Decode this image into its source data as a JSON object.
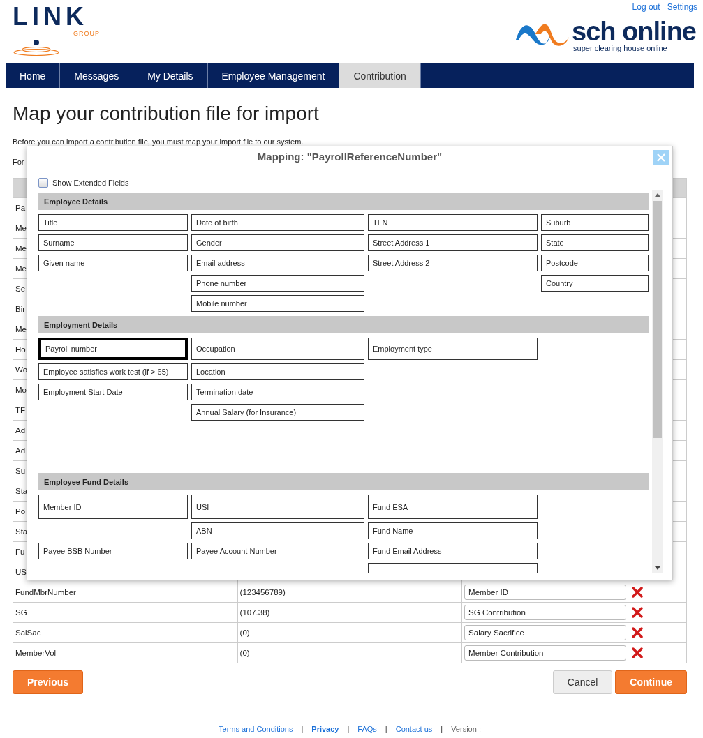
{
  "header": {
    "links": [
      "Log out",
      "Settings"
    ],
    "logo": {
      "name": "LINK",
      "sub": "GROUP"
    },
    "brand": {
      "name": "sch online",
      "tagline": "super clearing house online"
    }
  },
  "nav": [
    {
      "label": "Home",
      "selected": false
    },
    {
      "label": "Messages",
      "selected": false
    },
    {
      "label": "My Details",
      "selected": false
    },
    {
      "label": "Employee Management",
      "selected": false
    },
    {
      "label": "Contribution",
      "selected": true
    }
  ],
  "title": "Map your contribution file for import",
  "intro": "Before you can import a contribution file, you must map your import file to our system.",
  "intro_2": "For",
  "table": {
    "rows": [
      {
        "column_1": "Pa"
      },
      {
        "column_1": "Me"
      },
      {
        "column_1": "Me"
      },
      {
        "column_1": "Me"
      },
      {
        "column_1": "Se"
      },
      {
        "column_1": "Bir"
      },
      {
        "column_1": "Me"
      },
      {
        "column_1": "Ho"
      },
      {
        "column_1": "Wo"
      },
      {
        "column_1": "Mo"
      },
      {
        "column_1": "TF"
      },
      {
        "column_1": "Ad"
      },
      {
        "column_1": "Ad"
      },
      {
        "column_1": "Su"
      },
      {
        "column_1": "Sta"
      },
      {
        "column_1": "Po"
      },
      {
        "column_1": "Sta"
      },
      {
        "column_1": "Fu"
      },
      {
        "column_1": "US"
      },
      {
        "column_1": "FundMbrNumber",
        "column_2": "(123456789)",
        "column_3": "Member ID"
      },
      {
        "column_1": "SG",
        "column_2": "(107.38)",
        "column_3": "SG Contribution"
      },
      {
        "column_1": "SalSac",
        "column_2": "(0)",
        "column_3": "Salary Sacrifice"
      },
      {
        "column_1": "MemberVol",
        "column_2": "(0)",
        "column_3": "Member Contribution"
      }
    ]
  },
  "buttons": {
    "previous": "Previous",
    "cancel": "Cancel",
    "continue": "Continue"
  },
  "dialog": {
    "title": "Mapping: \"PayrollReferenceNumber\"",
    "show_extended": {
      "label": "Show Extended Fields",
      "checked": false
    },
    "sections": [
      {
        "title": "Employee Details",
        "rows": [
          [
            {
              "label": "Title",
              "selected": false
            },
            {
              "label": "Date of birth",
              "selected": false
            },
            {
              "label": "TFN",
              "selected": false
            },
            {
              "label": "Suburb",
              "selected": false
            }
          ],
          [
            {
              "label": "Surname",
              "selected": false
            },
            {
              "label": "Gender",
              "selected": false
            },
            {
              "label": "Street Address 1",
              "selected": false
            },
            {
              "label": "State",
              "selected": false
            }
          ],
          [
            {
              "label": "Given name",
              "selected": false
            },
            {
              "label": "Email address",
              "selected": false
            },
            {
              "label": "Street Address 2",
              "selected": false
            },
            {
              "label": "Postcode",
              "selected": false
            }
          ],
          [
            null,
            {
              "label": "Phone number",
              "selected": false
            },
            null,
            {
              "label": "Country",
              "selected": false
            }
          ],
          [
            null,
            {
              "label": "Mobile number",
              "selected": false
            },
            null,
            null
          ]
        ]
      },
      {
        "title": "Employment Details",
        "rows": [
          [
            {
              "label": "Payroll number",
              "selected": true
            },
            {
              "label": "Occupation",
              "selected": false
            },
            {
              "label": "Employment type",
              "selected": false
            },
            null
          ],
          [
            {
              "label": "Employee satisfies work test (if > 65)",
              "selected": false
            },
            {
              "label": "Location",
              "selected": false
            },
            null,
            null
          ],
          [
            {
              "label": "Employment Start Date",
              "selected": false
            },
            {
              "label": "Termination date",
              "selected": false
            },
            null,
            null
          ],
          [
            null,
            {
              "label": "Annual Salary (for Insurance)",
              "selected": false
            },
            null,
            null
          ]
        ]
      },
      {
        "title": "Employee Fund Details",
        "rows": [
          [
            {
              "label": "Member ID",
              "selected": false
            },
            {
              "label": "USI",
              "selected": false
            },
            {
              "label": "Fund ESA",
              "selected": false
            },
            null
          ],
          [
            null,
            {
              "label": "ABN",
              "selected": false
            },
            {
              "label": "Fund Name",
              "selected": false
            },
            null
          ],
          [
            {
              "label": "Payee BSB Number",
              "selected": false
            },
            {
              "label": "Payee Account Number",
              "selected": false
            },
            {
              "label": "Fund Email Address",
              "selected": false
            },
            null
          ],
          [
            null,
            null,
            {
              "selected": false
            },
            null
          ]
        ]
      }
    ]
  },
  "footer": [
    {
      "kind": "link",
      "label": "Terms and Conditions",
      "bold": false
    },
    {
      "kind": "separator",
      "label": "|"
    },
    {
      "kind": "link",
      "label": "Privacy",
      "bold": true
    },
    {
      "kind": "separator",
      "label": "|"
    },
    {
      "kind": "link",
      "label": "FAQs",
      "bold": false
    },
    {
      "kind": "separator",
      "label": "|"
    },
    {
      "kind": "link",
      "label": "Contact us",
      "bold": false
    },
    {
      "kind": "separator",
      "label": "|"
    },
    {
      "kind": "text",
      "label": "Version :",
      "bold": false
    }
  ]
}
